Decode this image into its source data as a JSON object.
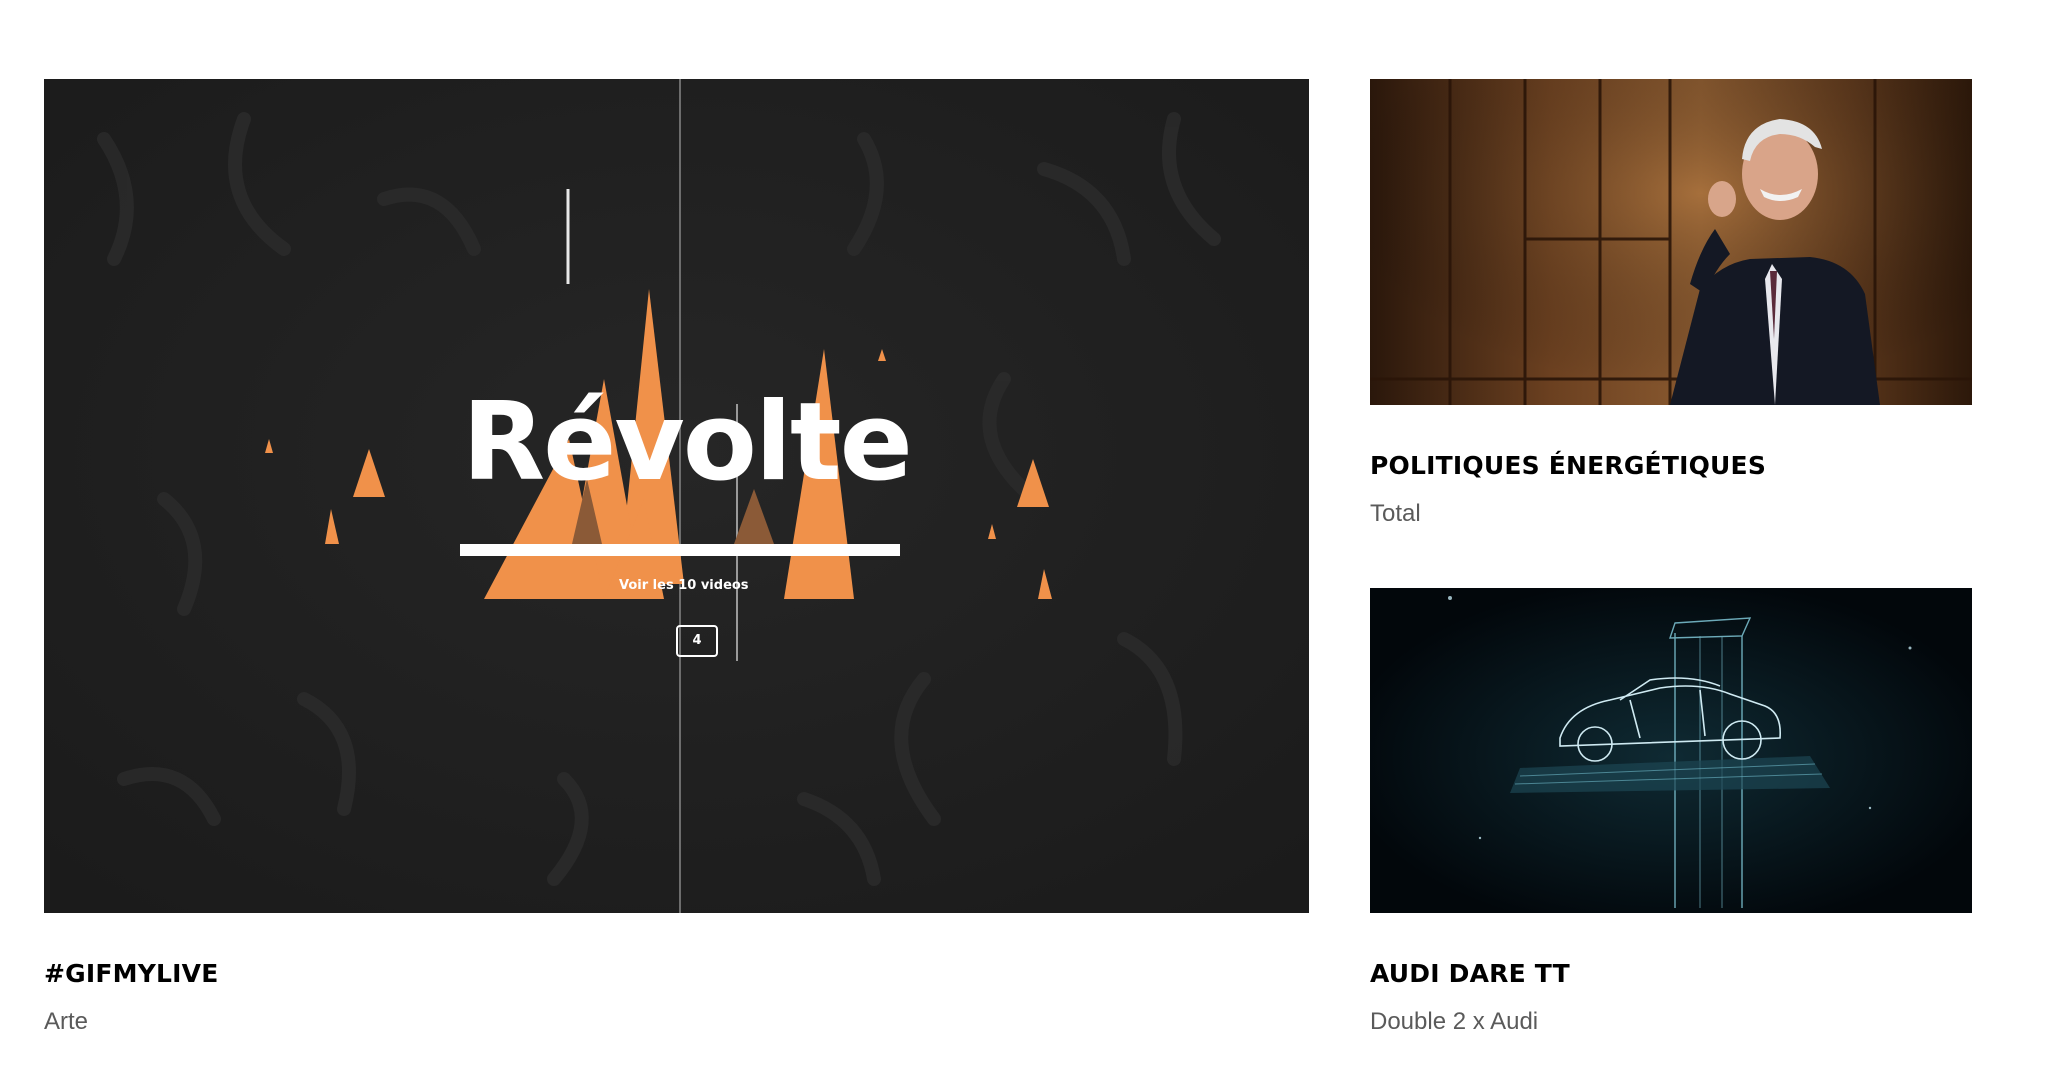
{
  "projects": [
    {
      "title": "#GIFMYLIVE",
      "client": "Arte",
      "thumbnail": {
        "headline": "Révolte",
        "link_text": "Voir les 10 videos",
        "comment_count": "4",
        "accent_color": "#f0914a"
      }
    },
    {
      "title": "POLITIQUES ÉNERGÉTIQUES",
      "client": "Total"
    },
    {
      "title": "AUDI DARE TT",
      "client": "Double 2 x Audi"
    }
  ]
}
